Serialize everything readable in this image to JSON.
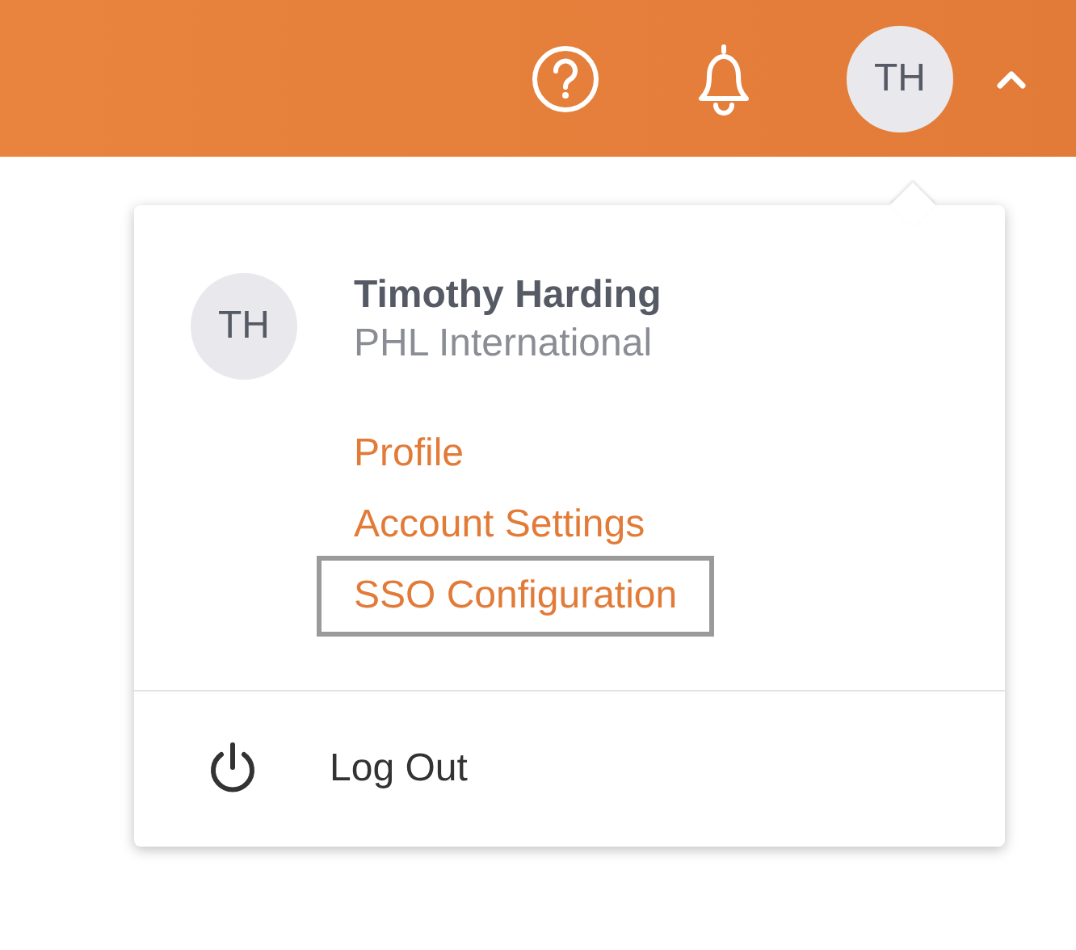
{
  "header": {
    "avatar_initials": "TH",
    "menu_open": true
  },
  "user_menu": {
    "avatar_initials": "TH",
    "name": "Timothy Harding",
    "organization": "PHL International",
    "links": [
      {
        "label": "Profile",
        "focused": false
      },
      {
        "label": "Account Settings",
        "focused": false
      },
      {
        "label": "SSO Configuration",
        "focused": true
      }
    ],
    "logout": "Log Out"
  }
}
